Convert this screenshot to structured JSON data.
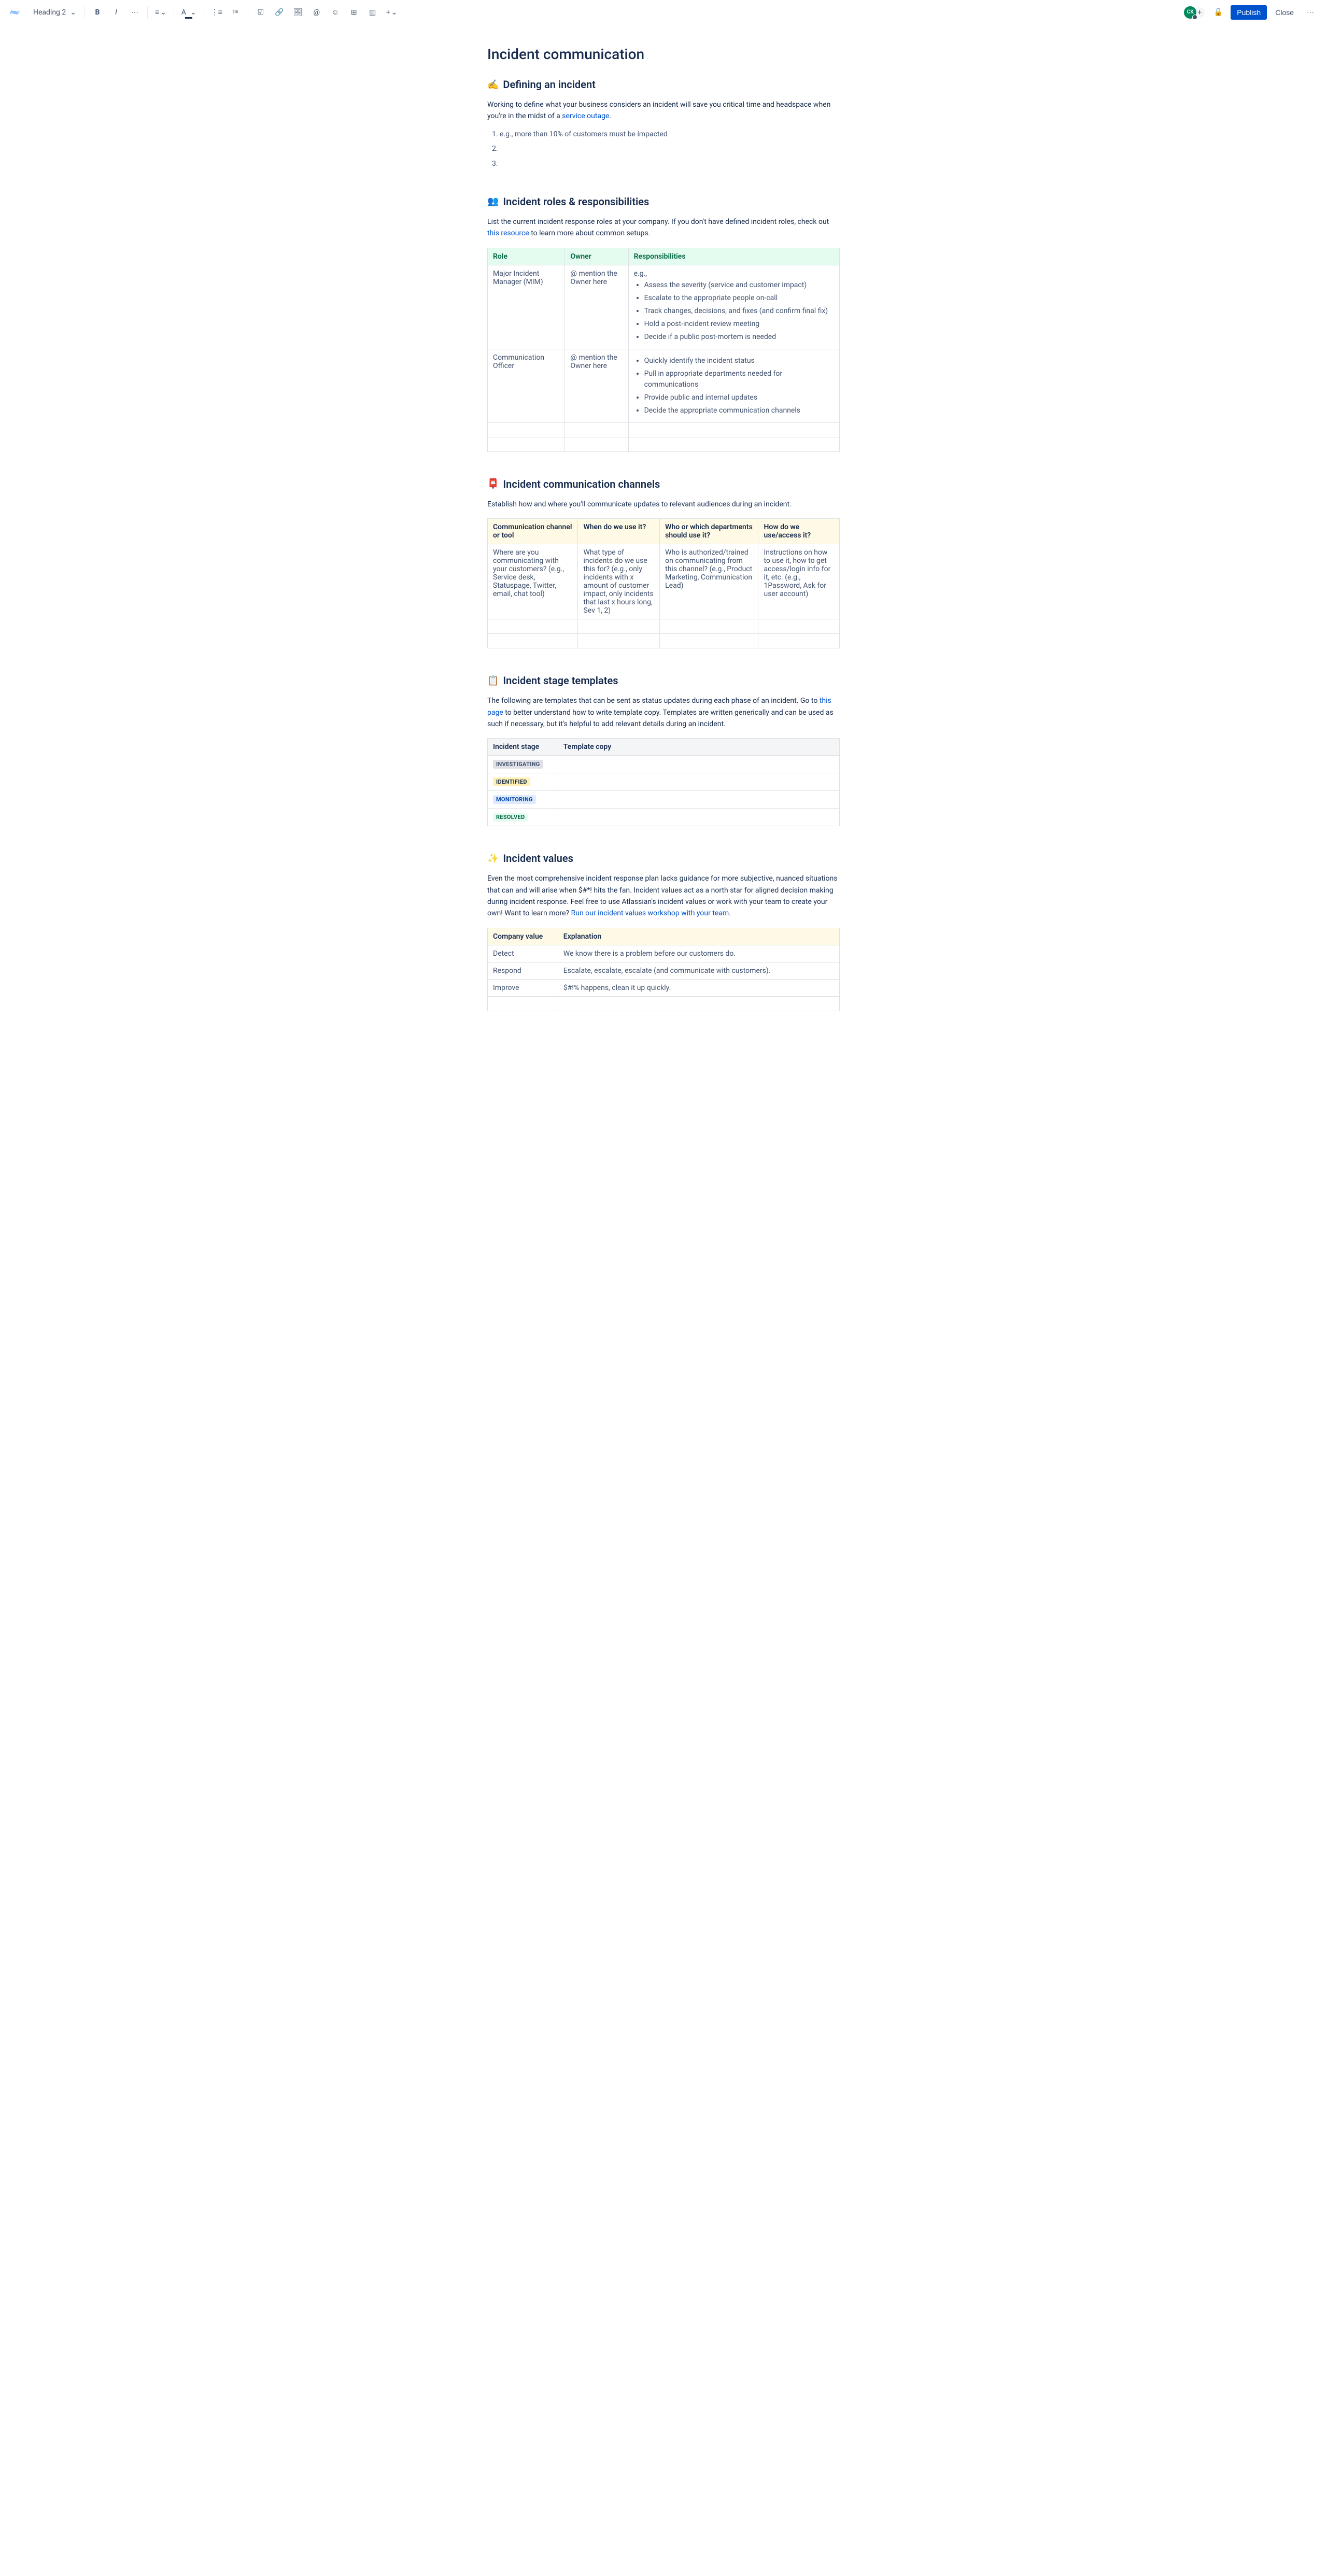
{
  "toolbar": {
    "text_style": "Heading 2",
    "publish_label": "Publish",
    "close_label": "Close",
    "avatar_initials": "CK"
  },
  "page": {
    "title": "Incident communication"
  },
  "sections": {
    "defining": {
      "emoji": "✍️",
      "heading": "Defining an incident",
      "intro_pre": "Working to define what your business considers an incident will save you critical time and headspace when you're in the midst of a ",
      "intro_link": "service outage",
      "intro_post": ".",
      "list": [
        "e.g., more than 10% of customers must be impacted",
        "",
        ""
      ]
    },
    "roles": {
      "emoji": "👥",
      "heading": "Incident roles & responsibilities",
      "intro_pre": "List the current incident response roles at your company. If you don't have defined incident roles, check out ",
      "intro_link": "this resource",
      "intro_post": " to learn more about common setups.",
      "headers": [
        "Role",
        "Owner",
        "Responsibilities"
      ],
      "rows": [
        {
          "role": "Major Incident Manager (MIM)",
          "owner": "@ mention the Owner here",
          "resp_prefix": "e.g.,",
          "resp": [
            "Assess the severity (service and customer impact)",
            "Escalate to the appropriate people on-call",
            "Track changes, decisions, and fixes (and confirm final fix)",
            "Hold a post-incident review meeting",
            "Decide if a public post-mortem is needed"
          ]
        },
        {
          "role": "Communication Officer",
          "owner": "@ mention the Owner here",
          "resp_prefix": "",
          "resp": [
            "Quickly identify the incident status",
            "Pull in appropriate departments needed for communications",
            "Provide public and internal updates",
            "Decide the appropriate communication channels"
          ]
        }
      ]
    },
    "channels": {
      "emoji": "📮",
      "heading": "Incident communication channels",
      "intro": "Establish how and where you'll communicate updates to relevant audiences during an incident.",
      "headers": [
        "Communication channel or tool",
        "When do we use it?",
        "Who or which departments should use it?",
        "How do we use/access it?"
      ],
      "row": [
        "Where are you communicating with your customers? (e.g., Service desk, Statuspage, Twitter, email, chat tool)",
        "What type of incidents do we use this for? (e.g., only incidents with x amount of customer impact, only incidents that last x hours long, Sev 1, 2)",
        "Who is authorized/trained on communicating from this channel? (e.g., Product Marketing, Communication Lead)",
        "Instructions on how to use it, how to get access/login info for it, etc. (e.g., 1Password, Ask for user account)"
      ]
    },
    "templates": {
      "emoji": "📋",
      "heading": "Incident stage templates",
      "intro_pre": "The following are templates that can be sent as status updates during each phase of an incident. Go to ",
      "intro_link": "this page",
      "intro_post": " to better understand how to write template copy. Templates are written generically and can be used as such if necessary, but it's helpful to add relevant details during an incident.",
      "headers": [
        "Incident stage",
        "Template copy"
      ],
      "stages": [
        {
          "label": "INVESTIGATING",
          "class": "badge-gray"
        },
        {
          "label": "IDENTIFIED",
          "class": "badge-yellow"
        },
        {
          "label": "MONITORING",
          "class": "badge-blue"
        },
        {
          "label": "RESOLVED",
          "class": "badge-green"
        }
      ]
    },
    "values": {
      "emoji": "✨",
      "heading": "Incident values",
      "intro_pre": "Even the most comprehensive incident response plan lacks guidance for more subjective, nuanced situations that can and will arise when $#*! hits the fan. Incident values act as a north star for aligned decision making during incident response. Feel free to use Atlassian's incident values or work with your team to create your own! Want to learn more? ",
      "intro_link": "Run our incident values workshop with your team",
      "intro_post": ".",
      "headers": [
        "Company value",
        "Explanation"
      ],
      "rows": [
        {
          "value": "Detect",
          "explanation": "We know there is a problem before our customers do."
        },
        {
          "value": "Respond",
          "explanation": "Escalate, escalate, escalate (and communicate with customers)."
        },
        {
          "value": "Improve",
          "explanation": "$#!% happens, clean it up quickly."
        }
      ]
    }
  }
}
